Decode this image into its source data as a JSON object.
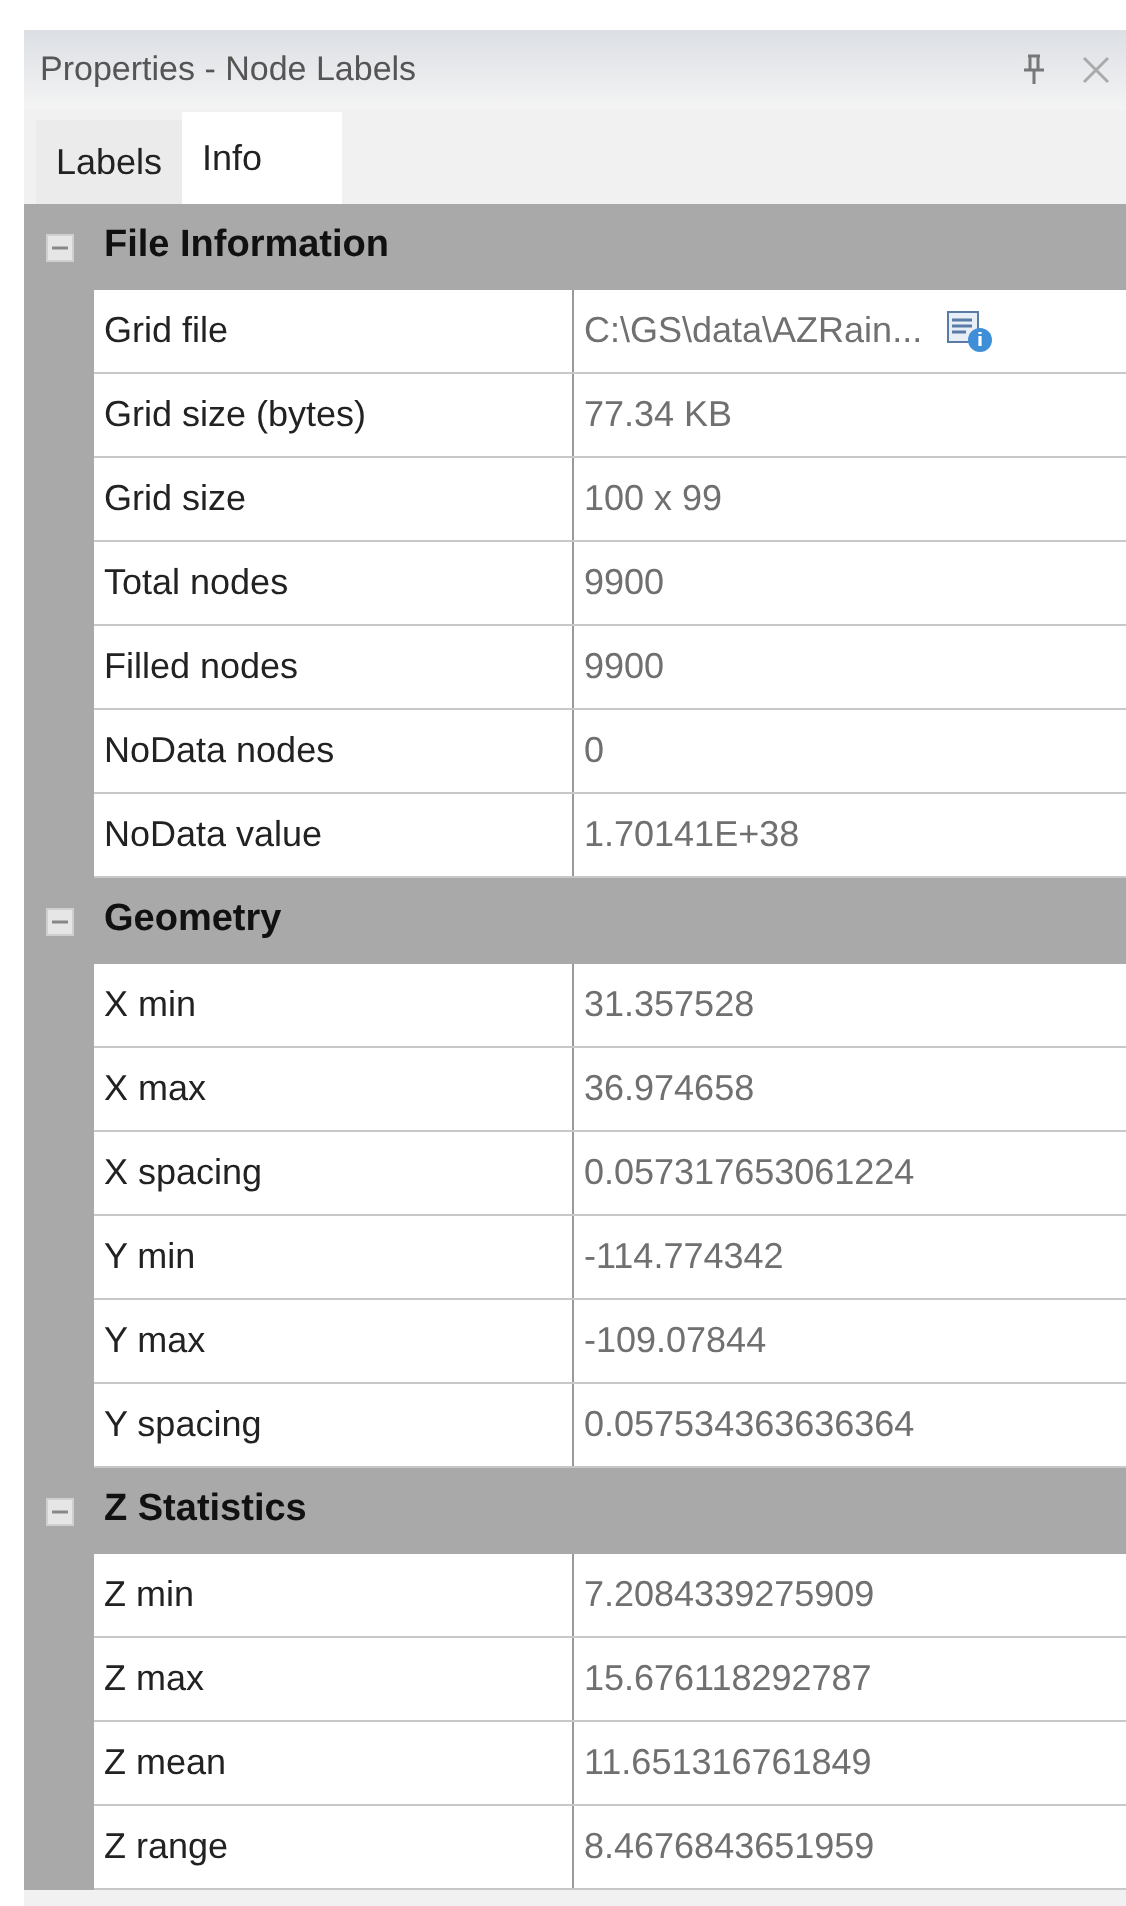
{
  "window": {
    "title": "Properties - Node Labels"
  },
  "tabs": [
    {
      "label": "Labels",
      "selected": false
    },
    {
      "label": "Info",
      "selected": true
    }
  ],
  "sections": [
    {
      "title": "File Information",
      "expanded": true,
      "rows": [
        {
          "name": "Grid file",
          "value": "C:\\GS\\data\\AZRain...",
          "kind": "file"
        },
        {
          "name": "Grid size (bytes)",
          "value": "77.34 KB",
          "kind": "text"
        },
        {
          "name": "Grid size",
          "value": "100 x 99",
          "kind": "text"
        },
        {
          "name": "Total nodes",
          "value": "9900",
          "kind": "text"
        },
        {
          "name": "Filled nodes",
          "value": "9900",
          "kind": "text"
        },
        {
          "name": "NoData nodes",
          "value": "0",
          "kind": "text"
        },
        {
          "name": "NoData value",
          "value": "1.70141E+38",
          "kind": "text"
        }
      ]
    },
    {
      "title": "Geometry",
      "expanded": true,
      "rows": [
        {
          "name": "X min",
          "value": "31.357528",
          "kind": "text"
        },
        {
          "name": "X max",
          "value": "36.974658",
          "kind": "text"
        },
        {
          "name": "X spacing",
          "value": "0.057317653061224",
          "kind": "text"
        },
        {
          "name": "Y min",
          "value": "-114.774342",
          "kind": "text"
        },
        {
          "name": "Y max",
          "value": "-109.07844",
          "kind": "text"
        },
        {
          "name": "Y spacing",
          "value": "0.057534363636364",
          "kind": "text"
        }
      ]
    },
    {
      "title": "Z Statistics",
      "expanded": true,
      "rows": [
        {
          "name": "Z min",
          "value": "7.2084339275909",
          "kind": "text"
        },
        {
          "name": "Z max",
          "value": "15.676118292787",
          "kind": "text"
        },
        {
          "name": "Z mean",
          "value": "11.651316761849",
          "kind": "text"
        },
        {
          "name": "Z range",
          "value": "8.4676843651959",
          "kind": "text"
        }
      ]
    }
  ]
}
